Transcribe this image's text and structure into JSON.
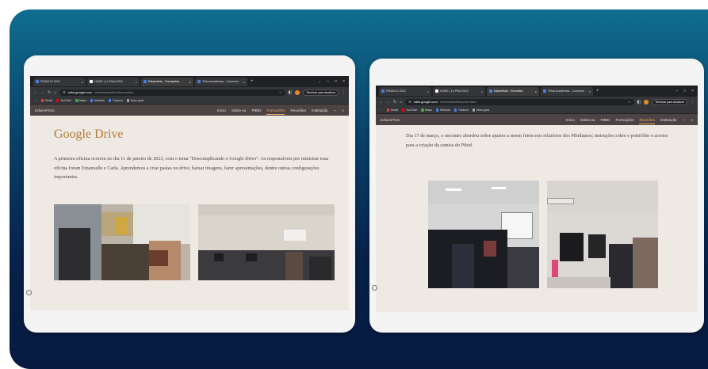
{
  "left_screen": {
    "browser": {
      "tabs": [
        {
          "label": "PIBID/UG 2022",
          "active": false
        },
        {
          "label": "HOME | Le Pibid 2022",
          "active": false
        },
        {
          "label": "Edianefloto - Formações",
          "active": true
        },
        {
          "label": "Trilha Acadêmica - Conhecer",
          "active": false
        }
      ],
      "url_host": "sites.google.com",
      "url_path": "/view/edianefloto/formações",
      "action_pill": "Terminar para atualizar",
      "bookmarks": [
        "Gmail",
        "YouTube",
        "Maps",
        "Notícias",
        "Traduzir",
        "Novo guia"
      ]
    },
    "site": {
      "brand": "EdianeFloto",
      "nav": [
        "Início",
        "Sobre eu",
        "PIBID",
        "Formações",
        "Reuniões",
        "Instituição"
      ],
      "current_nav": "Formações",
      "heading": "Google Drive",
      "paragraph": "A primeira oficina ocorreu no dia 11 de janeiro de 2023, com o tema \"Descomplicando o Google Drive\". As responsáveis por ministrar essa oficina foram Emanuelle e Carla. Aprendemos a criar pastas no drive, baixar imagens, fazer apresentações, dentre outras configurações importantes."
    }
  },
  "right_screen": {
    "browser": {
      "tabs": [
        {
          "label": "PIBID/UG 2022",
          "active": false
        },
        {
          "label": "HOME | Le Pibid 2022",
          "active": false
        },
        {
          "label": "Edianefloto - Reuniões",
          "active": true
        },
        {
          "label": "Trilha Acadêmica - Conhecer",
          "active": false
        }
      ],
      "url_host": "sites.google.com",
      "url_path": "/view/edianefloto/reuniões",
      "action_pill": "Terminar para atualizar",
      "bookmarks": [
        "Gmail",
        "YouTube",
        "Maps",
        "Notícias",
        "Traduzir",
        "Novo guia"
      ]
    },
    "site": {
      "brand": "EdianeFloto",
      "nav": [
        "Início",
        "Sobre eu",
        "PIBID",
        "Formações",
        "Reuniões",
        "Instituição"
      ],
      "current_nav": "Reuniões",
      "paragraph": "Dia 17 de março, o encontro abordou sobre ajustes a serem feitos nos relatórios dos Pibidianos; instruções sobre o portifólio e acertos para a criação da camisa do Pibid."
    }
  },
  "colors": {
    "accent_nav": "#f0a560",
    "heading": "#b57a38",
    "site_bar": "#4c4344",
    "page_bg": "#efe9e3"
  }
}
